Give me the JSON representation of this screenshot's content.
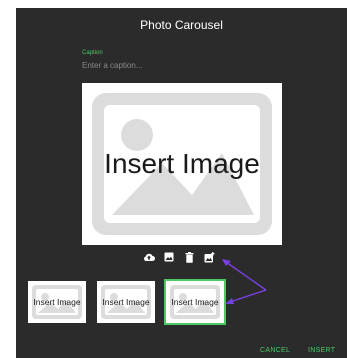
{
  "dialog": {
    "title": "Photo Carousel"
  },
  "caption": {
    "label": "Caption",
    "placeholder": "Enter a caption..."
  },
  "main_image": {
    "placeholder_text": "Insert Image"
  },
  "toolbar": {
    "icons": [
      "upload-icon",
      "image-icon",
      "delete-icon",
      "add-image-icon"
    ]
  },
  "thumbnails": [
    {
      "label": "Insert Image"
    },
    {
      "label": "Insert Image"
    },
    {
      "label": "Insert Image",
      "selected": true
    }
  ],
  "actions": {
    "cancel": "CANCEL",
    "insert": "INSERT"
  },
  "colors": {
    "dialog_bg": "#2b2b2b",
    "accent": "#4cc864",
    "annotation": "#7b3fe4"
  }
}
